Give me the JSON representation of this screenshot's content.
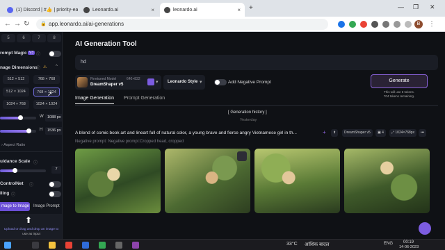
{
  "browser": {
    "tabs": [
      {
        "label": "(1) Discord | #👍 | priority-early...",
        "active": false
      },
      {
        "label": "Leonardo.ai",
        "active": false
      },
      {
        "label": "leonardo.ai",
        "active": true
      }
    ],
    "new_tab": "+",
    "url": "app.leonardo.ai/ai-generations",
    "profile_initial": "B"
  },
  "sidebar": {
    "image_counts": [
      "5",
      "6",
      "7",
      "8"
    ],
    "prompt_magic_label": "rompt Magic",
    "prompt_magic_badge": "V3",
    "image_dimensions_label": "nage Dimensions",
    "dimensions": [
      "512 × 512",
      "768 × 768",
      "512 × 1024",
      "768 × 1024",
      "1024 × 768",
      "1024 × 1024"
    ],
    "selected_dimension": "768 × 1024",
    "width_label": "W",
    "width_value": "1088 px",
    "height_label": "H",
    "height_value": "1536 px",
    "width_fraction": 0.55,
    "height_fraction": 0.78,
    "aspect_ratio_label": "Aspect Ratio",
    "guidance_scale_label": "uidance Scale",
    "guidance_value": "7",
    "guidance_fraction": 0.32,
    "controlnet_label": "ControlNet",
    "tiling_label": "iling",
    "image_to_image_tab": "mage to Image",
    "image_prompt_tab": "Image Prompt",
    "upload_text_1": "Upload or drag and drop an image to",
    "upload_text_2": "use as input"
  },
  "main": {
    "title": "AI Generation Tool",
    "prompt_value": "hd",
    "model": {
      "caption": "Finetuned Model",
      "size": "640×832",
      "name": "DreamShaper v5"
    },
    "style": "Leonardo Style",
    "negative_prompt_label": "Add Negative Prompt",
    "generate_label": "Generate",
    "token_note_1": "This will use 6 tokens.",
    "token_note_2": "704 tokens remaining.",
    "tabs": [
      "Image Generation",
      "Prompt Generation"
    ],
    "history_label": "Generation history",
    "yesterday_label": "Yesterday",
    "generation": {
      "prompt": "A blend of comic book art and lineart full of natural color, a young brave and fierce angry Vietnamese girl in th...",
      "negative": "Negative prompt: Negative prompt:Cropped head, cropped",
      "model": "DreamShaper v5",
      "count": "4",
      "size": "1024×768px"
    }
  },
  "taskbar": {
    "weather": "33°C",
    "weather_text": "आंशिक बादल",
    "language": "ENG",
    "time": "00:19",
    "date": "14-06-2023"
  },
  "colors": {
    "accent": "#7c5ce0",
    "generate_border": "#8a62d9"
  }
}
